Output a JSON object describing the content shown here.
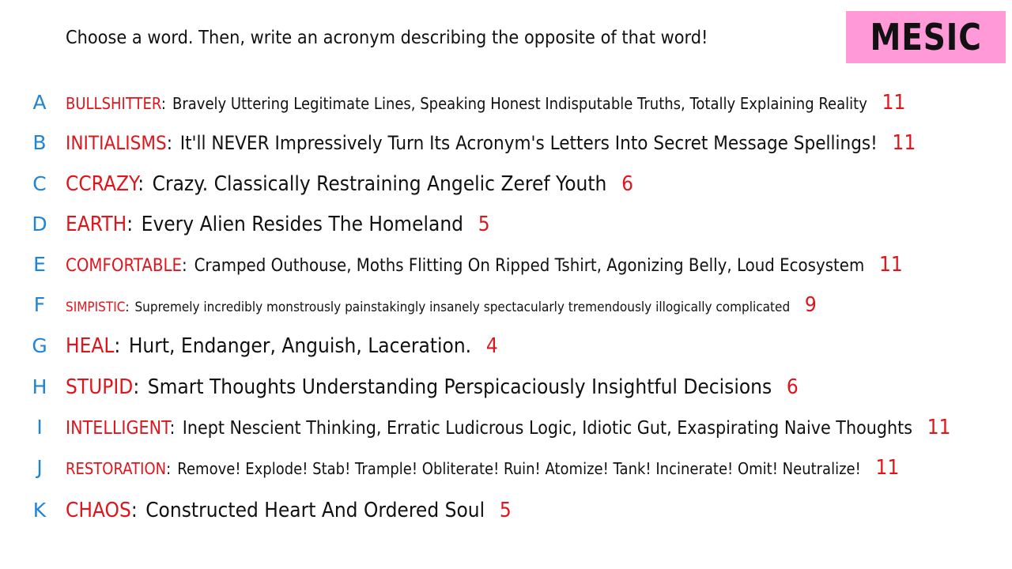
{
  "header": {
    "prompt": "Choose a word. Then, write an acronym describing the opposite of that word!",
    "badge": "MESIC"
  },
  "rows": [
    {
      "letter": "A",
      "word": "BULLSHITTER",
      "colon": ":",
      "phrase": "Bravely Uttering Legitimate Lines, Speaking Honest Indisputable Truths, Totally Explaining Reality",
      "count": "11"
    },
    {
      "letter": "B",
      "word": "INITIALISMS",
      "colon": ":",
      "phrase": "It'll NEVER Impressively Turn Its Acronym's Letters Into Secret Message Spellings!",
      "count": "11"
    },
    {
      "letter": "C",
      "word": "CCRAZY",
      "colon": ":",
      "phrase": "Crazy. Classically Restraining Angelic Zeref Youth",
      "count": "6"
    },
    {
      "letter": "D",
      "word": "EARTH",
      "colon": ":",
      "phrase": "Every Alien Resides The Homeland",
      "count": "5"
    },
    {
      "letter": "E",
      "word": "COMFORTABLE",
      "colon": ":",
      "phrase": "Cramped Outhouse, Moths Flitting On Ripped Tshirt, Agonizing Belly, Loud Ecosystem",
      "count": "11"
    },
    {
      "letter": "F",
      "word": "SIMPISTIC",
      "colon": ":",
      "phrase": "Supremely incredibly monstrously painstakingly insanely spectacularly tremendously illogically complicated",
      "count": "9"
    },
    {
      "letter": "G",
      "word": "HEAL",
      "colon": ":",
      "phrase": "Hurt, Endanger, Anguish, Laceration.",
      "count": "4"
    },
    {
      "letter": "H",
      "word": "STUPID",
      "colon": ":",
      "phrase": "Smart Thoughts Understanding Perspicaciously Insightful Decisions",
      "count": "6"
    },
    {
      "letter": "I",
      "word": "INTELLIGENT",
      "colon": ":",
      "phrase": "Inept Nescient Thinking, Erratic Ludicrous Logic, Idiotic Gut, Exaspirating Naive Thoughts",
      "count": "11"
    },
    {
      "letter": "J",
      "word": "RESTORATION",
      "colon": ":",
      "phrase": "Remove! Explode! Stab! Trample! Obliterate! Ruin! Atomize! Tank! Incinerate! Omit! Neutralize!",
      "count": "11"
    },
    {
      "letter": "K",
      "word": "CHAOS",
      "colon": ":",
      "phrase": "Constructed Heart And Ordered Soul",
      "count": "5"
    }
  ]
}
